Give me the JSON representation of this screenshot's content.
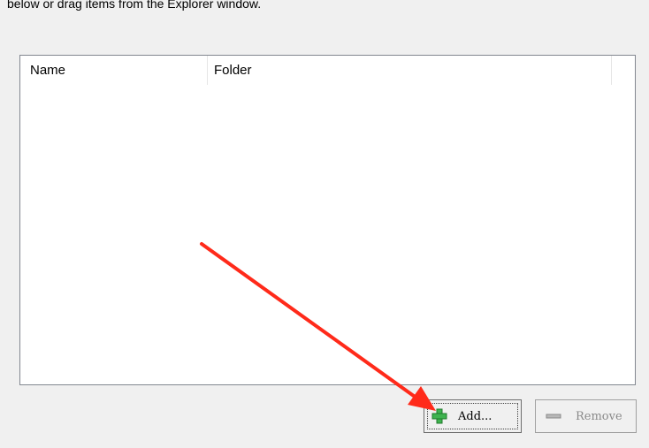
{
  "instruction_text": "below or drag items from the Explorer window.",
  "listview": {
    "columns": [
      "Name",
      "Folder"
    ],
    "rows": []
  },
  "buttons": {
    "add_label": "Add...",
    "remove_label": "Remove"
  },
  "colors": {
    "add_icon": "#3fb34f",
    "annotation_arrow": "#ff2a1a",
    "disabled_text": "#8a8a8a"
  },
  "icons": {
    "add": "plus-icon",
    "remove": "minus-icon"
  }
}
